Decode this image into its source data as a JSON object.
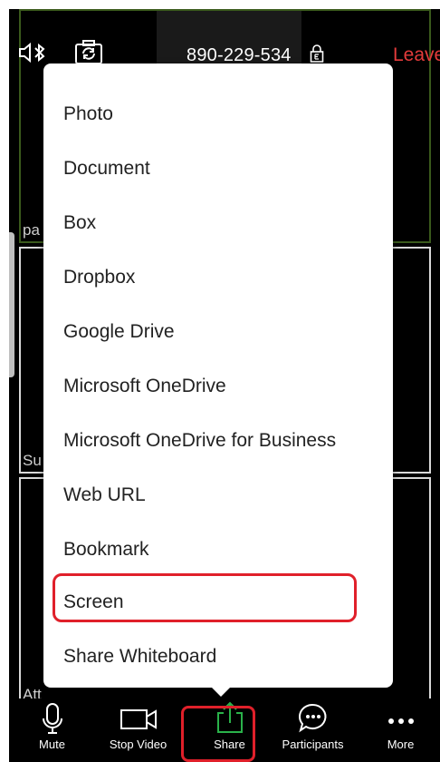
{
  "top_bar": {
    "meeting_id": "890-229-534",
    "leave_label": "Leave"
  },
  "tiles": [
    {
      "name": "pa"
    },
    {
      "name": "Su"
    },
    {
      "name": "Att"
    }
  ],
  "share_menu": {
    "items": [
      "Photo",
      "Document",
      "Box",
      "Dropbox",
      "Google Drive",
      "Microsoft OneDrive",
      "Microsoft OneDrive for Business",
      "Web URL",
      "Bookmark",
      "Screen",
      "Share Whiteboard"
    ],
    "highlighted_item": "Screen"
  },
  "toolbar": {
    "mute": "Mute",
    "stop_video": "Stop Video",
    "share": "Share",
    "participants": "Participants",
    "more": "More"
  },
  "colors": {
    "leave": "#e43b3b",
    "share_accent": "#2ab24a",
    "highlight": "#e0202a"
  }
}
